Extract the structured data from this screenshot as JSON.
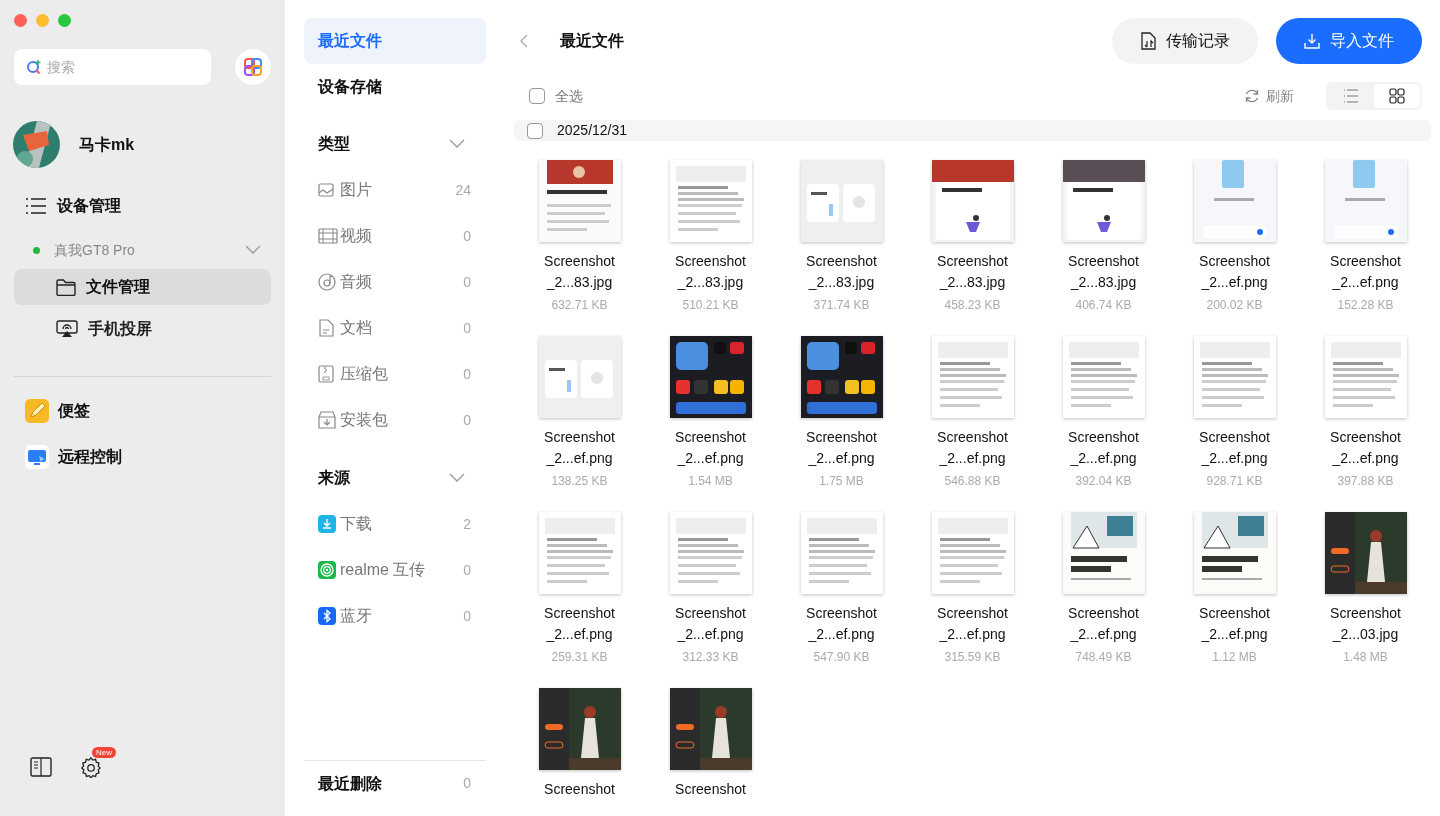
{
  "sidebar": {
    "search": {
      "placeholder": "搜索"
    },
    "user": {
      "name": "马卡mk"
    },
    "section": {
      "label": "设备管理"
    },
    "device": {
      "name": "真我GT8 Pro",
      "online": true,
      "expanded": true
    },
    "items": [
      {
        "label": "文件管理",
        "selected": true
      },
      {
        "label": "手机投屏",
        "selected": false
      }
    ],
    "apps": [
      {
        "label": "便签"
      },
      {
        "label": "远程控制"
      }
    ],
    "settings_badge": "New"
  },
  "nav": {
    "top": [
      {
        "label": "最近文件",
        "selected": true
      },
      {
        "label": "设备存储",
        "selected": false
      }
    ],
    "groups": [
      {
        "title": "类型",
        "expanded": true,
        "items": [
          {
            "label": "图片",
            "count": "24"
          },
          {
            "label": "视频",
            "count": "0"
          },
          {
            "label": "音频",
            "count": "0"
          },
          {
            "label": "文档",
            "count": "0"
          },
          {
            "label": "压缩包",
            "count": "0"
          },
          {
            "label": "安装包",
            "count": "0"
          }
        ]
      },
      {
        "title": "来源",
        "expanded": true,
        "items": [
          {
            "label": "下载",
            "count": "2"
          },
          {
            "label": "realme 互传",
            "count": "0"
          },
          {
            "label": "蓝牙",
            "count": "0"
          }
        ]
      }
    ],
    "footer": {
      "label": "最近删除",
      "count": "0"
    }
  },
  "main": {
    "title": "最近文件",
    "buttons": [
      {
        "label": "传输记录",
        "kind": "secondary"
      },
      {
        "label": "导入文件",
        "kind": "primary"
      }
    ],
    "select_all": {
      "label": "全选",
      "checked": false
    },
    "refresh": "刷新",
    "views": [
      {
        "kind": "list",
        "selected": false
      },
      {
        "kind": "grid",
        "selected": true
      }
    ],
    "groups": [
      {
        "date": "2025/12/31",
        "checked": false,
        "files": [
          {
            "name": [
              "Screenshot",
              "_2...83.jpg"
            ],
            "size": "632.71 KB"
          },
          {
            "name": [
              "Screenshot",
              "_2...83.jpg"
            ],
            "size": "510.21 KB"
          },
          {
            "name": [
              "Screenshot",
              "_2...83.jpg"
            ],
            "size": "371.74 KB"
          },
          {
            "name": [
              "Screenshot",
              "_2...83.jpg"
            ],
            "size": "458.23 KB"
          },
          {
            "name": [
              "Screenshot",
              "_2...83.jpg"
            ],
            "size": "406.74 KB"
          },
          {
            "name": [
              "Screenshot",
              "_2...ef.png"
            ],
            "size": "200.02 KB"
          },
          {
            "name": [
              "Screenshot",
              "_2...ef.png"
            ],
            "size": "152.28 KB"
          },
          {
            "name": [
              "Screenshot",
              "_2...ef.png"
            ],
            "size": "138.25 KB"
          },
          {
            "name": [
              "Screenshot",
              "_2...ef.png"
            ],
            "size": "1.54 MB"
          },
          {
            "name": [
              "Screenshot",
              "_2...ef.png"
            ],
            "size": "1.75 MB"
          },
          {
            "name": [
              "Screenshot",
              "_2...ef.png"
            ],
            "size": "546.88 KB"
          },
          {
            "name": [
              "Screenshot",
              "_2...ef.png"
            ],
            "size": "392.04 KB"
          },
          {
            "name": [
              "Screenshot",
              "_2...ef.png"
            ],
            "size": "928.71 KB"
          },
          {
            "name": [
              "Screenshot",
              "_2...ef.png"
            ],
            "size": "397.88 KB"
          },
          {
            "name": [
              "Screenshot",
              "_2...ef.png"
            ],
            "size": "259.31 KB"
          },
          {
            "name": [
              "Screenshot",
              "_2...ef.png"
            ],
            "size": "312.33 KB"
          },
          {
            "name": [
              "Screenshot",
              "_2...ef.png"
            ],
            "size": "547.90 KB"
          },
          {
            "name": [
              "Screenshot",
              "_2...ef.png"
            ],
            "size": "315.59 KB"
          },
          {
            "name": [
              "Screenshot",
              "_2...ef.png"
            ],
            "size": "748.49 KB"
          },
          {
            "name": [
              "Screenshot",
              "_2...ef.png"
            ],
            "size": "1.12 MB"
          },
          {
            "name": [
              "Screenshot",
              "_2...03.jpg"
            ],
            "size": "1.48 MB"
          },
          {
            "name": [
              "Screenshot"
            ]
          },
          {
            "name": [
              "Screenshot"
            ]
          }
        ]
      }
    ]
  }
}
